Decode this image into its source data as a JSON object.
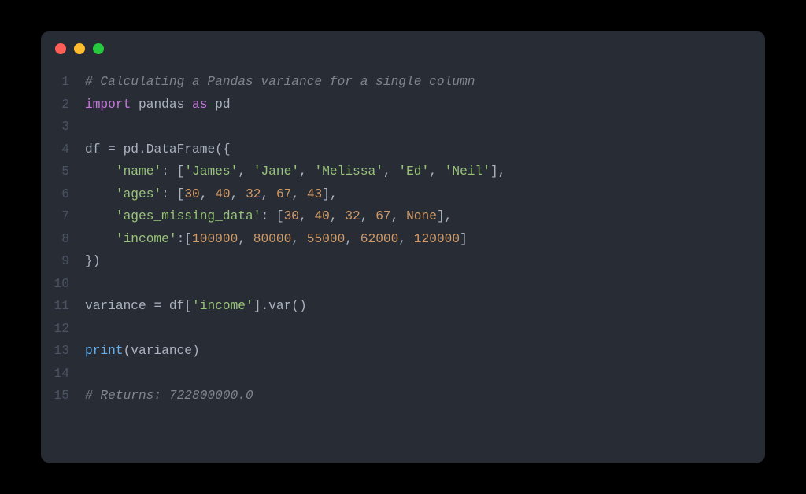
{
  "window": {
    "dots": [
      "red",
      "yellow",
      "green"
    ]
  },
  "code": {
    "lines": [
      {
        "n": "1",
        "tokens": [
          {
            "c": "tok-comment",
            "t": "# Calculating a Pandas variance for a single column"
          }
        ]
      },
      {
        "n": "2",
        "tokens": [
          {
            "c": "tok-keyword",
            "t": "import"
          },
          {
            "c": "tok-default",
            "t": " pandas "
          },
          {
            "c": "tok-keyword",
            "t": "as"
          },
          {
            "c": "tok-default",
            "t": " pd"
          }
        ]
      },
      {
        "n": "3",
        "tokens": []
      },
      {
        "n": "4",
        "tokens": [
          {
            "c": "tok-default",
            "t": "df "
          },
          {
            "c": "tok-punct",
            "t": "="
          },
          {
            "c": "tok-default",
            "t": " pd.DataFrame"
          },
          {
            "c": "tok-punct",
            "t": "({"
          }
        ]
      },
      {
        "n": "5",
        "tokens": [
          {
            "c": "tok-default",
            "t": "    "
          },
          {
            "c": "tok-string",
            "t": "'name'"
          },
          {
            "c": "tok-punct",
            "t": ": ["
          },
          {
            "c": "tok-string",
            "t": "'James'"
          },
          {
            "c": "tok-punct",
            "t": ", "
          },
          {
            "c": "tok-string",
            "t": "'Jane'"
          },
          {
            "c": "tok-punct",
            "t": ", "
          },
          {
            "c": "tok-string",
            "t": "'Melissa'"
          },
          {
            "c": "tok-punct",
            "t": ", "
          },
          {
            "c": "tok-string",
            "t": "'Ed'"
          },
          {
            "c": "tok-punct",
            "t": ", "
          },
          {
            "c": "tok-string",
            "t": "'Neil'"
          },
          {
            "c": "tok-punct",
            "t": "],"
          }
        ]
      },
      {
        "n": "6",
        "tokens": [
          {
            "c": "tok-default",
            "t": "    "
          },
          {
            "c": "tok-string",
            "t": "'ages'"
          },
          {
            "c": "tok-punct",
            "t": ": ["
          },
          {
            "c": "tok-number",
            "t": "30"
          },
          {
            "c": "tok-punct",
            "t": ", "
          },
          {
            "c": "tok-number",
            "t": "40"
          },
          {
            "c": "tok-punct",
            "t": ", "
          },
          {
            "c": "tok-number",
            "t": "32"
          },
          {
            "c": "tok-punct",
            "t": ", "
          },
          {
            "c": "tok-number",
            "t": "67"
          },
          {
            "c": "tok-punct",
            "t": ", "
          },
          {
            "c": "tok-number",
            "t": "43"
          },
          {
            "c": "tok-punct",
            "t": "],"
          }
        ]
      },
      {
        "n": "7",
        "tokens": [
          {
            "c": "tok-default",
            "t": "    "
          },
          {
            "c": "tok-string",
            "t": "'ages_missing_data'"
          },
          {
            "c": "tok-punct",
            "t": ": ["
          },
          {
            "c": "tok-number",
            "t": "30"
          },
          {
            "c": "tok-punct",
            "t": ", "
          },
          {
            "c": "tok-number",
            "t": "40"
          },
          {
            "c": "tok-punct",
            "t": ", "
          },
          {
            "c": "tok-number",
            "t": "32"
          },
          {
            "c": "tok-punct",
            "t": ", "
          },
          {
            "c": "tok-number",
            "t": "67"
          },
          {
            "c": "tok-punct",
            "t": ", "
          },
          {
            "c": "tok-none",
            "t": "None"
          },
          {
            "c": "tok-punct",
            "t": "],"
          }
        ]
      },
      {
        "n": "8",
        "tokens": [
          {
            "c": "tok-default",
            "t": "    "
          },
          {
            "c": "tok-string",
            "t": "'income'"
          },
          {
            "c": "tok-punct",
            "t": ":["
          },
          {
            "c": "tok-number",
            "t": "100000"
          },
          {
            "c": "tok-punct",
            "t": ", "
          },
          {
            "c": "tok-number",
            "t": "80000"
          },
          {
            "c": "tok-punct",
            "t": ", "
          },
          {
            "c": "tok-number",
            "t": "55000"
          },
          {
            "c": "tok-punct",
            "t": ", "
          },
          {
            "c": "tok-number",
            "t": "62000"
          },
          {
            "c": "tok-punct",
            "t": ", "
          },
          {
            "c": "tok-number",
            "t": "120000"
          },
          {
            "c": "tok-punct",
            "t": "]"
          }
        ]
      },
      {
        "n": "9",
        "tokens": [
          {
            "c": "tok-punct",
            "t": "})"
          }
        ]
      },
      {
        "n": "10",
        "tokens": []
      },
      {
        "n": "11",
        "tokens": [
          {
            "c": "tok-default",
            "t": "variance "
          },
          {
            "c": "tok-punct",
            "t": "="
          },
          {
            "c": "tok-default",
            "t": " df["
          },
          {
            "c": "tok-string",
            "t": "'income'"
          },
          {
            "c": "tok-default",
            "t": "].var()"
          }
        ]
      },
      {
        "n": "12",
        "tokens": []
      },
      {
        "n": "13",
        "tokens": [
          {
            "c": "tok-func",
            "t": "print"
          },
          {
            "c": "tok-punct",
            "t": "("
          },
          {
            "c": "tok-default",
            "t": "variance"
          },
          {
            "c": "tok-punct",
            "t": ")"
          }
        ]
      },
      {
        "n": "14",
        "tokens": []
      },
      {
        "n": "15",
        "tokens": [
          {
            "c": "tok-comment",
            "t": "# Returns: 722800000.0"
          }
        ]
      }
    ]
  }
}
